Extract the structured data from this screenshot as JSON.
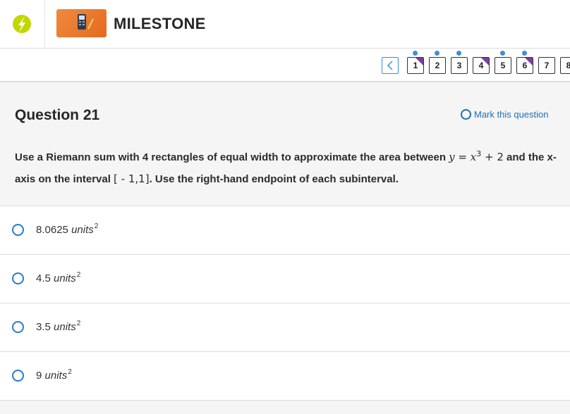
{
  "header": {
    "brand": "MILESTONE",
    "colors": {
      "logo": "#c4d600",
      "thumb": "#ec7a2e"
    }
  },
  "nav": {
    "prev_icon": "chevron-left-icon",
    "questions": [
      {
        "label": "1",
        "answered": true,
        "flagged": true
      },
      {
        "label": "2",
        "answered": true,
        "flagged": false
      },
      {
        "label": "3",
        "answered": true,
        "flagged": false
      },
      {
        "label": "4",
        "answered": false,
        "flagged": true
      },
      {
        "label": "5",
        "answered": true,
        "flagged": false
      },
      {
        "label": "6",
        "answered": true,
        "flagged": true
      },
      {
        "label": "7",
        "answered": false,
        "flagged": false
      },
      {
        "label": "8",
        "answered": false,
        "flagged": false
      }
    ]
  },
  "question": {
    "title": "Question 21",
    "mark_label": "Mark this question",
    "text_a": "Use a Riemann sum with 4 rectangles of equal width to approximate the area between ",
    "eq_lhs": "y",
    "eq_mid": " = ",
    "eq_x": "x",
    "eq_exp": "3",
    "eq_rhs": " + 2",
    "text_b": " and the x-axis on the interval ",
    "interval": "[ - 1,1]",
    "text_c": ". Use the right-hand endpoint of each subinterval."
  },
  "answers": [
    {
      "value": "8.0625",
      "unit": "units",
      "exp": "2"
    },
    {
      "value": "4.5",
      "unit": "units",
      "exp": "2"
    },
    {
      "value": "3.5",
      "unit": "units",
      "exp": "2"
    },
    {
      "value": "9",
      "unit": "units",
      "exp": "2"
    }
  ]
}
